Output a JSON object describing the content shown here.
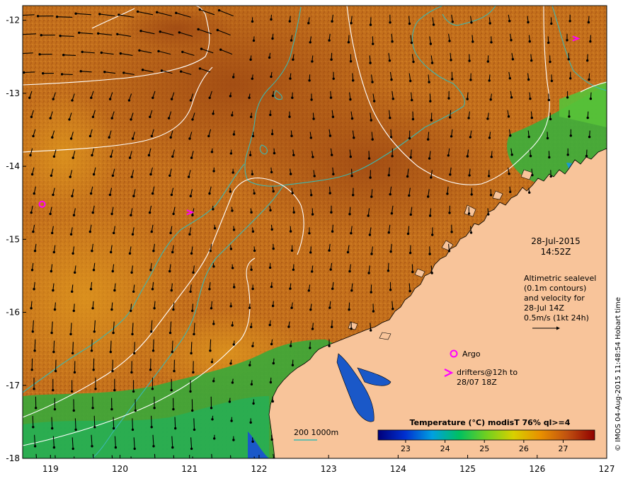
{
  "map": {
    "lon_range": [
      118.6,
      127.0
    ],
    "lat_range": [
      -18.0,
      -11.8
    ],
    "x_ticks": [
      {
        "value": 119,
        "label": "119"
      },
      {
        "value": 120,
        "label": "120"
      },
      {
        "value": 121,
        "label": "121"
      },
      {
        "value": 122,
        "label": "122"
      },
      {
        "value": 123,
        "label": "123"
      },
      {
        "value": 124,
        "label": "124"
      },
      {
        "value": 125,
        "label": "125"
      },
      {
        "value": 126,
        "label": "126"
      },
      {
        "value": 127,
        "label": "127"
      }
    ],
    "y_ticks": [
      {
        "value": -12,
        "label": "-12"
      },
      {
        "value": -13,
        "label": "-13"
      },
      {
        "value": -14,
        "label": "-14"
      },
      {
        "value": -15,
        "label": "-15"
      },
      {
        "value": -16,
        "label": "-16"
      },
      {
        "value": -17,
        "label": "-17"
      },
      {
        "value": -18,
        "label": "-18"
      }
    ],
    "colors": {
      "land": "#f8c49a",
      "ocean_warm": "#c4701c",
      "ocean_hot": "#a85014",
      "contour": "#ffffff",
      "bathymetry": "#3cb8b0",
      "marker": "#ff00ff",
      "coast_cool": "#2aa848",
      "coast_cold": "#1848c0"
    }
  },
  "info": {
    "date": "28-Jul-2015",
    "time": "14:52Z",
    "alt_line1": "Altimetric sealevel",
    "alt_line2": "(0.1m contours)",
    "alt_line3": "and velocity for",
    "alt_line4": "28-Jul 14Z",
    "velocity_scale": "0.5m/s (1kt 24h)",
    "argo_label": "Argo",
    "drifters_line1": "drifters@12h to",
    "drifters_line2": "28/07 18Z",
    "bathymetry_legend": "200  1000m"
  },
  "colorbar": {
    "title": "Temperature (°C) modisT 76% ql>=4",
    "ticks": [
      "23",
      "24",
      "25",
      "26",
      "27"
    ],
    "tick_values": [
      23,
      24,
      25,
      26,
      27
    ],
    "range": [
      22.3,
      27.8
    ],
    "stops": [
      "#00007a",
      "#0030d0",
      "#00a0e0",
      "#00c060",
      "#70d020",
      "#d8d000",
      "#e89000",
      "#c05010",
      "#900000"
    ]
  },
  "stamp": "© IMOS 04-Aug-2015 11:48:54 Hobart time",
  "argo_float": {
    "lon": 118.88,
    "lat": -14.52
  },
  "drifters": [
    {
      "lon": 121.0,
      "lat": -14.63
    },
    {
      "lon": 126.55,
      "lat": -12.25
    }
  ]
}
